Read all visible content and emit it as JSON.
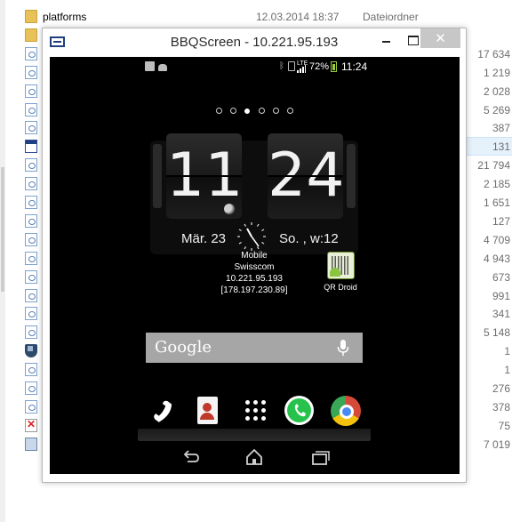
{
  "explorer": {
    "rows": [
      {
        "icon": "folder-icon",
        "name": "platforms",
        "date": "12.03.2014 18:37",
        "type": "Dateiordner",
        "size": ""
      },
      {
        "icon": "folder-icon",
        "name": "",
        "date": "",
        "type": "",
        "size": ""
      },
      {
        "icon": "file-icon",
        "name": "",
        "date": "",
        "type": "",
        "size": "17 634"
      },
      {
        "icon": "file-icon",
        "name": "",
        "date": "",
        "type": "",
        "size": "1 219"
      },
      {
        "icon": "file-icon",
        "name": "",
        "date": "",
        "type": "",
        "size": "2 028"
      },
      {
        "icon": "file-icon",
        "name": "",
        "date": "",
        "type": "",
        "size": "5 269"
      },
      {
        "icon": "file-icon",
        "name": "",
        "date": "",
        "type": "",
        "size": "387"
      },
      {
        "icon": "app-window-icon",
        "name": "",
        "date": "",
        "type": "",
        "size": "131",
        "selected": true
      },
      {
        "icon": "file-icon",
        "name": "",
        "date": "",
        "type": "",
        "size": "21 794"
      },
      {
        "icon": "file-icon",
        "name": "",
        "date": "",
        "type": "",
        "size": "2 185"
      },
      {
        "icon": "file-icon",
        "name": "",
        "date": "",
        "type": "",
        "size": "1 651"
      },
      {
        "icon": "file-icon",
        "name": "",
        "date": "",
        "type": "",
        "size": "127"
      },
      {
        "icon": "file-icon",
        "name": "",
        "date": "",
        "type": "",
        "size": "4 709"
      },
      {
        "icon": "file-icon",
        "name": "",
        "date": "",
        "type": "",
        "size": "4 943"
      },
      {
        "icon": "file-icon",
        "name": "",
        "date": "",
        "type": "",
        "size": "673"
      },
      {
        "icon": "file-icon",
        "name": "",
        "date": "",
        "type": "",
        "size": "991"
      },
      {
        "icon": "file-icon",
        "name": "",
        "date": "",
        "type": "",
        "size": "341"
      },
      {
        "icon": "file-icon",
        "name": "",
        "date": "",
        "type": "",
        "size": "5 148"
      },
      {
        "icon": "shield-icon",
        "name": "",
        "date": "",
        "type": "",
        "size": "1"
      },
      {
        "icon": "file-icon",
        "name": "",
        "date": "",
        "type": "",
        "size": "1"
      },
      {
        "icon": "file-icon",
        "name": "",
        "date": "",
        "type": "",
        "size": "276"
      },
      {
        "icon": "file-icon",
        "name": "",
        "date": "",
        "type": "",
        "size": "378"
      },
      {
        "icon": "delete-file-icon",
        "name": "",
        "date": "",
        "type": "",
        "size": "75"
      },
      {
        "icon": "setup-icon",
        "name": "",
        "date": "",
        "type": "",
        "size": "7 019"
      }
    ]
  },
  "window": {
    "title": "BBQScreen - 10.221.95.193",
    "close_label": "✕"
  },
  "phone": {
    "status_bar": {
      "network_type": "LTE",
      "battery_percent": "72%",
      "battery_level": 0.72,
      "time": "11:24"
    },
    "home_pages": {
      "count": 6,
      "active_index": 2
    },
    "clock_widget": {
      "hour": "11",
      "minute": "24",
      "date": "Mär. 23",
      "day_week": "So. , w:12"
    },
    "mobile_info": {
      "label": "Mobile",
      "carrier": "Swisscom",
      "ip_local": "10.221.95.193",
      "ip_public": "[178.197.230.89]"
    },
    "qr_app": {
      "label": "QR Droid",
      "icon": "qr-droid-icon"
    },
    "search": {
      "logo_text": "Google",
      "icon": "mic-icon"
    },
    "dock": [
      {
        "name": "phone",
        "icon": "phone-icon"
      },
      {
        "name": "contacts",
        "icon": "contacts-icon"
      },
      {
        "name": "app-drawer",
        "icon": "app-drawer-icon"
      },
      {
        "name": "whatsapp",
        "icon": "whatsapp-icon"
      },
      {
        "name": "chrome",
        "icon": "chrome-icon"
      }
    ],
    "nav": [
      {
        "name": "back",
        "icon": "back-icon"
      },
      {
        "name": "home",
        "icon": "home-icon"
      },
      {
        "name": "recent-apps",
        "icon": "recent-apps-icon"
      }
    ]
  },
  "colors": {
    "phone_bg": "#000000",
    "search_bar": "#a6a6a6",
    "battery": "#9ccc3a",
    "whatsapp": "#27c24c",
    "close_button": "#c7c7c7"
  }
}
